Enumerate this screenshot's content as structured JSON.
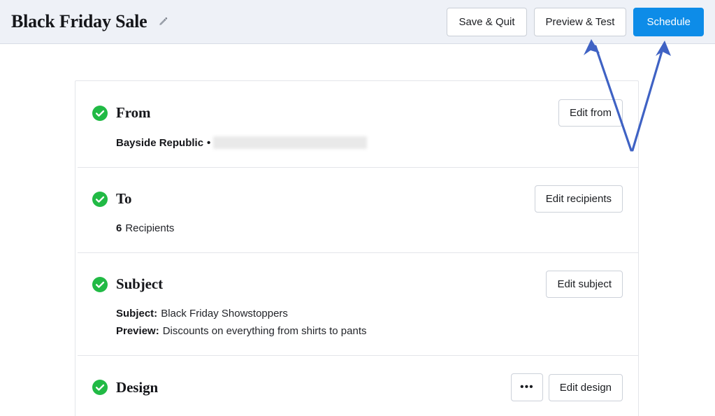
{
  "header": {
    "campaign_title": "Black Friday Sale",
    "edit_title_icon": "pencil-icon",
    "buttons": {
      "save_quit": "Save & Quit",
      "preview_test": "Preview & Test",
      "schedule": "Schedule"
    }
  },
  "colors": {
    "header_background": "#eef1f7",
    "primary_button": "#0d8ce8",
    "check_green": "#21ba45",
    "annotation_arrow": "#3f62c4",
    "card_border": "#e3e5e9"
  },
  "checklist": {
    "from": {
      "title": "From",
      "status_icon": "check-circle-icon",
      "edit_label": "Edit from",
      "sender_name": "Bayside Republic",
      "separator": "•",
      "sender_email_redacted": true
    },
    "to": {
      "title": "To",
      "status_icon": "check-circle-icon",
      "edit_label": "Edit recipients",
      "recipient_count": "6",
      "recipient_word": "Recipients"
    },
    "subject": {
      "title": "Subject",
      "status_icon": "check-circle-icon",
      "edit_label": "Edit subject",
      "subject_label": "Subject:",
      "subject_value": "Black Friday Showstoppers",
      "preview_label": "Preview:",
      "preview_value": "Discounts on everything from shirts to pants"
    },
    "design": {
      "title": "Design",
      "status_icon": "check-circle-icon",
      "more_label": "•••",
      "edit_label": "Edit design"
    }
  },
  "annotations": {
    "arrow_left_name": "arrow-to-preview-test",
    "arrow_right_name": "arrow-to-schedule"
  }
}
